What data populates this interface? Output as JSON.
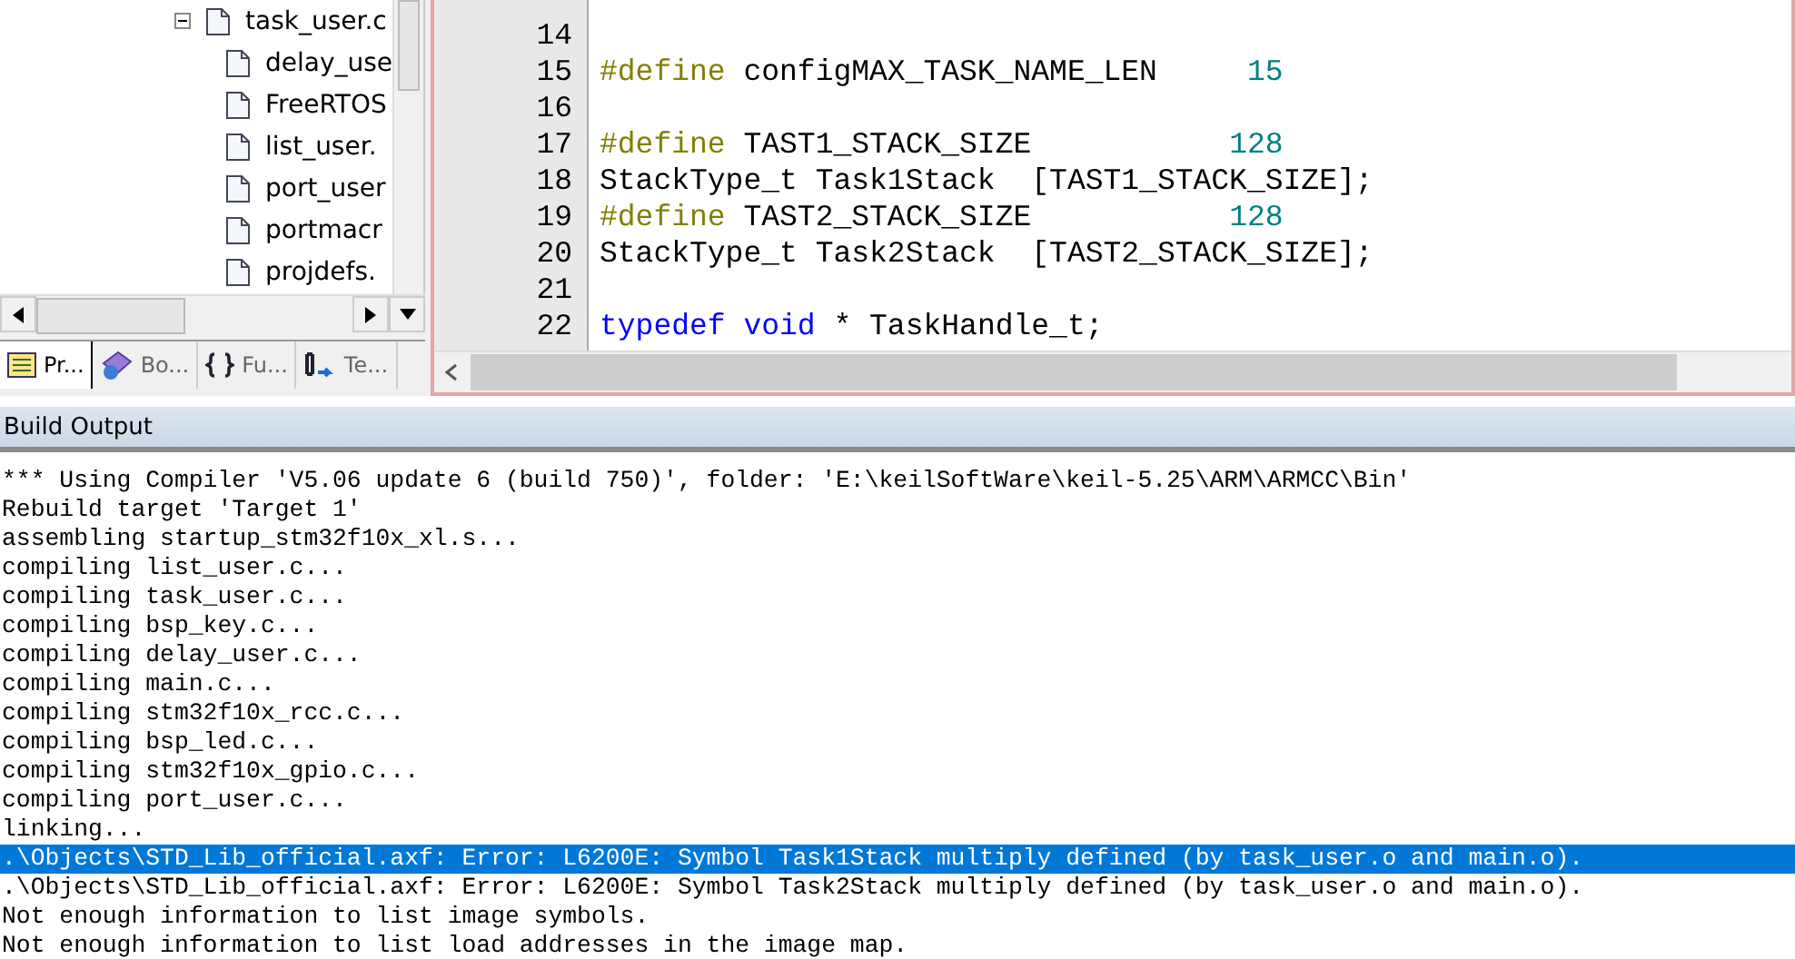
{
  "project_tree": {
    "items": [
      {
        "label": "task_user.c",
        "expanded": true,
        "children": [
          {
            "label": "delay_use"
          },
          {
            "label": "FreeRTOS"
          },
          {
            "label": "list_user."
          },
          {
            "label": "port_user"
          },
          {
            "label": "portmacr"
          },
          {
            "label": "projdefs."
          }
        ]
      }
    ]
  },
  "panel_tabs": [
    {
      "label": "Pr...",
      "selected": true
    },
    {
      "label": "Bo...",
      "selected": false
    },
    {
      "label": "Fu...",
      "selected": false
    },
    {
      "label": "Te...",
      "selected": false
    }
  ],
  "editor": {
    "lines": [
      {
        "number": "14"
      },
      {
        "number": "15",
        "tokens": [
          {
            "kind": "directive",
            "text": "#define"
          },
          {
            "kind": "plain",
            "text": " configMAX_TASK_NAME_LEN     "
          },
          {
            "kind": "number",
            "text": "15"
          }
        ]
      },
      {
        "number": "16"
      },
      {
        "number": "17",
        "tokens": [
          {
            "kind": "directive",
            "text": "#define"
          },
          {
            "kind": "plain",
            "text": " TAST1_STACK_SIZE           "
          },
          {
            "kind": "number",
            "text": "128"
          }
        ]
      },
      {
        "number": "18",
        "tokens": [
          {
            "kind": "plain",
            "text": "StackType_t Task1Stack  [TAST1_STACK_SIZE];"
          }
        ]
      },
      {
        "number": "19",
        "tokens": [
          {
            "kind": "directive",
            "text": "#define"
          },
          {
            "kind": "plain",
            "text": " TAST2_STACK_SIZE           "
          },
          {
            "kind": "number",
            "text": "128"
          }
        ]
      },
      {
        "number": "20",
        "tokens": [
          {
            "kind": "plain",
            "text": "StackType_t Task2Stack  [TAST2_STACK_SIZE];"
          }
        ]
      },
      {
        "number": "21"
      },
      {
        "number": "22",
        "tokens": [
          {
            "kind": "keyword",
            "text": "typedef"
          },
          {
            "kind": "keyword",
            "text": " void"
          },
          {
            "kind": "plain",
            "text": " * TaskHandle_t;"
          }
        ]
      }
    ]
  },
  "build_output": {
    "title": "Build Output",
    "lines": [
      {
        "text": "*** Using Compiler 'V5.06 update 6 (build 750)', folder: 'E:\\keilSoftWare\\keil-5.25\\ARM\\ARMCC\\Bin'",
        "selected": false
      },
      {
        "text": "Rebuild target 'Target 1'",
        "selected": false
      },
      {
        "text": "assembling startup_stm32f10x_xl.s...",
        "selected": false
      },
      {
        "text": "compiling list_user.c...",
        "selected": false
      },
      {
        "text": "compiling task_user.c...",
        "selected": false
      },
      {
        "text": "compiling bsp_key.c...",
        "selected": false
      },
      {
        "text": "compiling delay_user.c...",
        "selected": false
      },
      {
        "text": "compiling main.c...",
        "selected": false
      },
      {
        "text": "compiling stm32f10x_rcc.c...",
        "selected": false
      },
      {
        "text": "compiling bsp_led.c...",
        "selected": false
      },
      {
        "text": "compiling stm32f10x_gpio.c...",
        "selected": false
      },
      {
        "text": "compiling port_user.c...",
        "selected": false
      },
      {
        "text": "linking...",
        "selected": false
      },
      {
        "text": ".\\Objects\\STD_Lib_official.axf: Error: L6200E: Symbol Task1Stack multiply defined (by task_user.o and main.o).",
        "selected": true
      },
      {
        "text": ".\\Objects\\STD_Lib_official.axf: Error: L6200E: Symbol Task2Stack multiply defined (by task_user.o and main.o).",
        "selected": false
      },
      {
        "text": "Not enough information to list image symbols.",
        "selected": false
      },
      {
        "text": "Not enough information to list load addresses in the image map.",
        "selected": false
      }
    ]
  }
}
